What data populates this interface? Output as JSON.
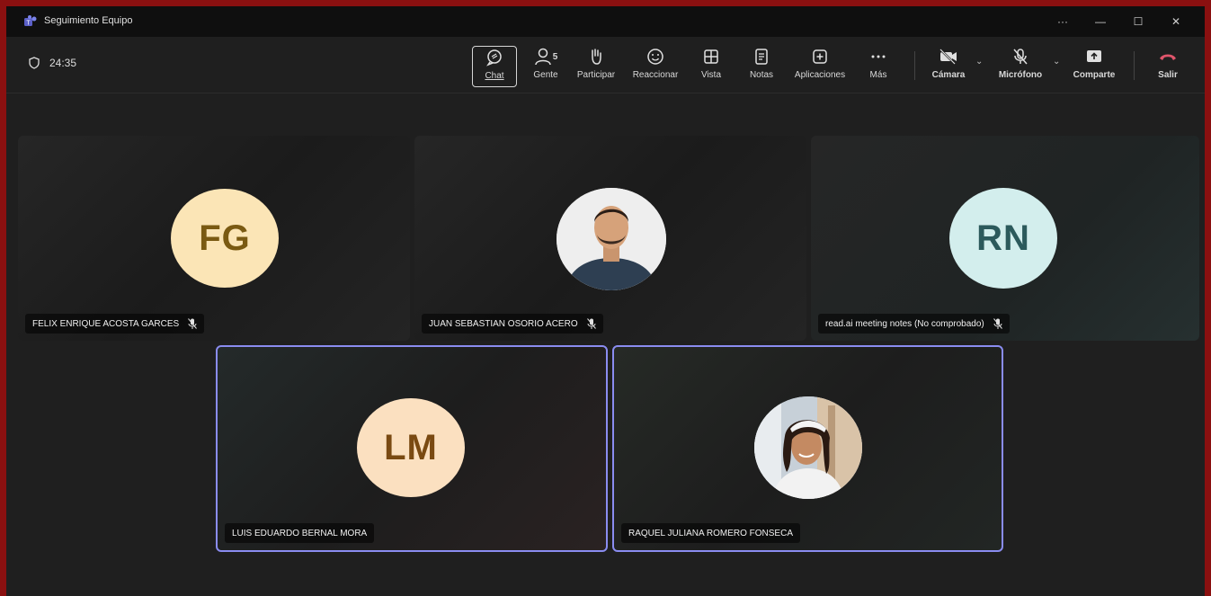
{
  "window": {
    "title": "Seguimiento Equipo",
    "controls": [
      "···",
      "—",
      "☐",
      "✕"
    ]
  },
  "meeting": {
    "timer": "24:35",
    "toolbar": {
      "chat": "Chat",
      "people": "Gente",
      "people_count": "5",
      "raise_hand": "Participar",
      "react": "Reaccionar",
      "view": "Vista",
      "notes": "Notas",
      "apps": "Aplicaciones",
      "more": "Más",
      "camera": "Cámara",
      "microphone": "Micrófono",
      "share": "Comparte",
      "leave": "Salir"
    }
  },
  "participants": [
    {
      "initials": "FG",
      "name": "FELIX ENRIQUE ACOSTA GARCES",
      "muted": true,
      "avatar_bg": "#fbe5b6",
      "avatar_fg": "#7a5a12"
    },
    {
      "initials": "",
      "name": "JUAN SEBASTIAN OSORIO ACERO",
      "muted": true,
      "photo": true
    },
    {
      "initials": "RN",
      "name": "read.ai meeting notes (No comprobado)",
      "muted": true,
      "avatar_bg": "#d3eeed",
      "avatar_fg": "#2c5a5c"
    },
    {
      "initials": "LM",
      "name": "LUIS EDUARDO BERNAL MORA",
      "muted": false,
      "avatar_bg": "#fbe0c0",
      "avatar_fg": "#7a4a12"
    },
    {
      "initials": "",
      "name": "RAQUEL JULIANA ROMERO FONSECA",
      "muted": false,
      "photo": true
    }
  ],
  "colors": {
    "active_border": "#8a8cf0",
    "leave": "#e0556b",
    "frame": "#8a1010"
  }
}
